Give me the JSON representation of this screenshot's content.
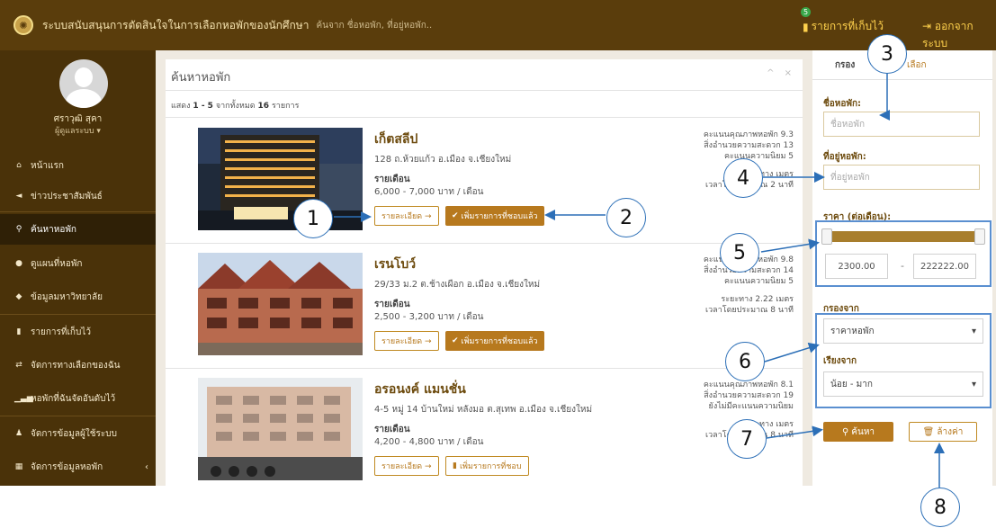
{
  "header": {
    "app_title": "ระบบสนับสนุนการตัดสินใจในการเลือกหอพักของนักศึกษา",
    "search_hint": "ค้นจาก ชื่อหอพัก, ที่อยู่หอพัก..",
    "saved_badge": "5",
    "saved_label": "รายการที่เก็บไว้",
    "logout_label": "ออกจากระบบ"
  },
  "user": {
    "name": "ศราวุฒิ สุคา",
    "role": "ผู้ดูแลระบบ ▾"
  },
  "sidebar": {
    "items": [
      {
        "label": "หน้าแรก",
        "icon": "home-icon"
      },
      {
        "label": "ข่าวประชาสัมพันธ์",
        "icon": "bullhorn-icon"
      },
      {
        "label": "ค้นหาหอพัก",
        "icon": "search-icon"
      },
      {
        "label": "ดูแผนที่หอพัก",
        "icon": "map-marker-icon"
      },
      {
        "label": "ข้อมูลมหาวิทยาลัย",
        "icon": "graduation-cap-icon"
      },
      {
        "label": "รายการที่เก็บไว้",
        "icon": "bookmark-icon"
      },
      {
        "label": "จัดการทางเลือกของฉัน",
        "icon": "exchange-icon"
      },
      {
        "label": "หอพักที่ฉันจัดอันดับไว้",
        "icon": "bar-chart-icon"
      },
      {
        "label": "จัดการข้อมูลผู้ใช้ระบบ",
        "icon": "user-icon"
      },
      {
        "label": "จัดการข้อมูลหอพัก",
        "icon": "building-icon"
      }
    ],
    "submenu_caret": "‹"
  },
  "main": {
    "title": "ค้นหาหอพัก",
    "tools": "^ ×",
    "count_prefix": "แสดง",
    "count_range": "1 - 5",
    "count_mid": "จากทั้งหมด",
    "count_total": "16",
    "count_suffix": "รายการ",
    "listings": [
      {
        "name": "เก็ตสลีป",
        "address": "128 ถ.ห้วยแก้ว อ.เมือง จ.เชียงใหม่",
        "monthly_label": "รายเดือน",
        "price": "6,000 - 7,000 บาท / เดือน",
        "detail_label": "รายละเอียด →",
        "fav_label": "เพิ่มรายการที่ชอบแล้ว",
        "stats": [
          "คะแนนคุณภาพหอพัก 9.3",
          "สิ่งอำนวยความสะดวก 13",
          "คะแนนความนิยม 5",
          "ระยะทาง เมตร",
          "เวลาโดยประมาณ 2 นาที"
        ]
      },
      {
        "name": "เรนโบว์",
        "address": "29/33 ม.2 ต.ช้างเผือก อ.เมือง จ.เชียงใหม่",
        "monthly_label": "รายเดือน",
        "price": "2,500 - 3,200 บาท / เดือน",
        "detail_label": "รายละเอียด →",
        "fav_label": "เพิ่มรายการที่ชอบแล้ว",
        "stats": [
          "คะแนนคุณภาพหอพัก 9.8",
          "สิ่งอำนวยความสะดวก 14",
          "คะแนนความนิยม 5",
          "ระยะทาง 2.22 เมตร",
          "เวลาโดยประมาณ 8 นาที"
        ]
      },
      {
        "name": "อรอนงค์ แมนชั่น",
        "address": "4-5 หมู่ 14 บ้านใหม่ หลังมอ ต.สุเทพ อ.เมือง จ.เชียงใหม่",
        "monthly_label": "รายเดือน",
        "price": "4,200 - 4,800 บาท / เดือน",
        "detail_label": "รายละเอียด →",
        "fav_label": "เพิ่มรายการที่ชอบ",
        "stats": [
          "คะแนนคุณภาพหอพัก 8.1",
          "สิ่งอำนวยความสะดวก 19",
          "ยังไม่มีคะแนนความนิยม",
          "ระยะทาง เมตร",
          "เวลาโดยประมาณ 8 นาที"
        ]
      }
    ]
  },
  "filter": {
    "tab_filter": "กรอง",
    "tab_other": "เลือก",
    "name_label": "ชื่อหอพัก:",
    "name_placeholder": "ชื่อหอพัก",
    "address_label": "ที่อยู่หอพัก:",
    "address_placeholder": "ที่อยู่หอพัก",
    "price_label": "ราคา (ต่อเดือน):",
    "price_min": "2300.00",
    "price_max": "222222.00",
    "price_sep": "-",
    "filter_by_label": "กรองจาก",
    "filter_by_value": "ราคาหอพัก",
    "sort_label": "เรียงจาก",
    "sort_value": "น้อย - มาก",
    "search_button": "ค้นหา",
    "clear_button": "ล้างค่า"
  },
  "annotations": [
    "1",
    "2",
    "3",
    "4",
    "5",
    "6",
    "7",
    "8"
  ],
  "colors": {
    "brand": "#5a3d0c",
    "accent": "#b7791e",
    "callout": "#2c6fb7"
  }
}
